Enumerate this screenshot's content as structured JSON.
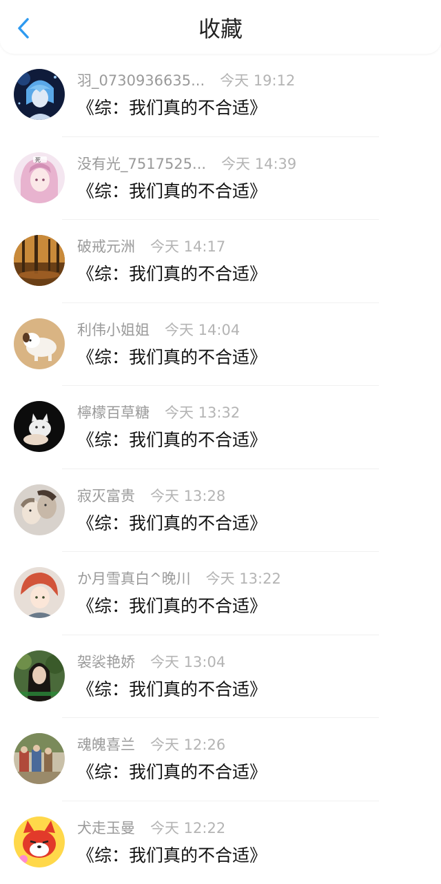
{
  "header": {
    "title": "收藏",
    "back_icon": "chevron-left-icon",
    "accent_color": "#2e9af0"
  },
  "items": [
    {
      "user": "羽_0730936635...",
      "time": "今天 19:12",
      "book": "《综：我们真的不合适》",
      "avatar": "anime-blue-hair-avatar"
    },
    {
      "user": "没有光_7517525...",
      "time": "今天 14:39",
      "book": "《综：我们真的不合适》",
      "avatar": "anime-pink-girl-avatar"
    },
    {
      "user": "破戒元洲",
      "time": "今天 14:17",
      "book": "《综：我们真的不合适》",
      "avatar": "autumn-forest-avatar"
    },
    {
      "user": "利伟小姐姐",
      "time": "今天 14:04",
      "book": "《综：我们真的不合适》",
      "avatar": "white-puppy-avatar"
    },
    {
      "user": "檸檬百草糖",
      "time": "今天 13:32",
      "book": "《综：我们真的不合适》",
      "avatar": "white-kitten-avatar"
    },
    {
      "user": "寂灭富贵",
      "time": "今天 13:28",
      "book": "《综：我们真的不合适》",
      "avatar": "couple-photo-avatar"
    },
    {
      "user": "か月雪真白^晚川",
      "time": "今天 13:22",
      "book": "《综：我们真的不合适》",
      "avatar": "anime-red-hair-avatar"
    },
    {
      "user": "袈裟艳娇",
      "time": "今天 13:04",
      "book": "《综：我们真的不合适》",
      "avatar": "girl-green-background-avatar"
    },
    {
      "user": "魂魄喜兰",
      "time": "今天 12:26",
      "book": "《综：我们真的不合适》",
      "avatar": "group-photo-avatar"
    },
    {
      "user": "犬走玉曼",
      "time": "今天 12:22",
      "book": "《综：我们真的不合适》",
      "avatar": "cartoon-red-fox-avatar"
    }
  ]
}
